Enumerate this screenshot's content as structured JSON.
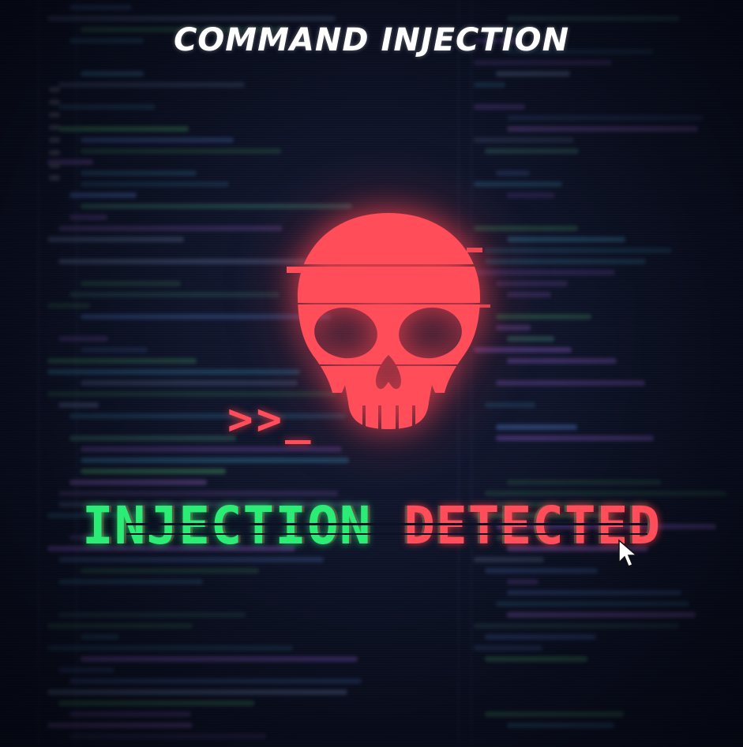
{
  "title": "COMMAND INJECTION",
  "prompt": ">>_",
  "headline": {
    "part1": "INJECTION",
    "part2": "DETECTED"
  },
  "icons": {
    "skull": "skull-icon",
    "cursor": "mouse-pointer-icon"
  },
  "colors": {
    "background": "#0c1124",
    "danger": "#ff4d5a",
    "success": "#2bec74",
    "title": "#ffffff"
  }
}
